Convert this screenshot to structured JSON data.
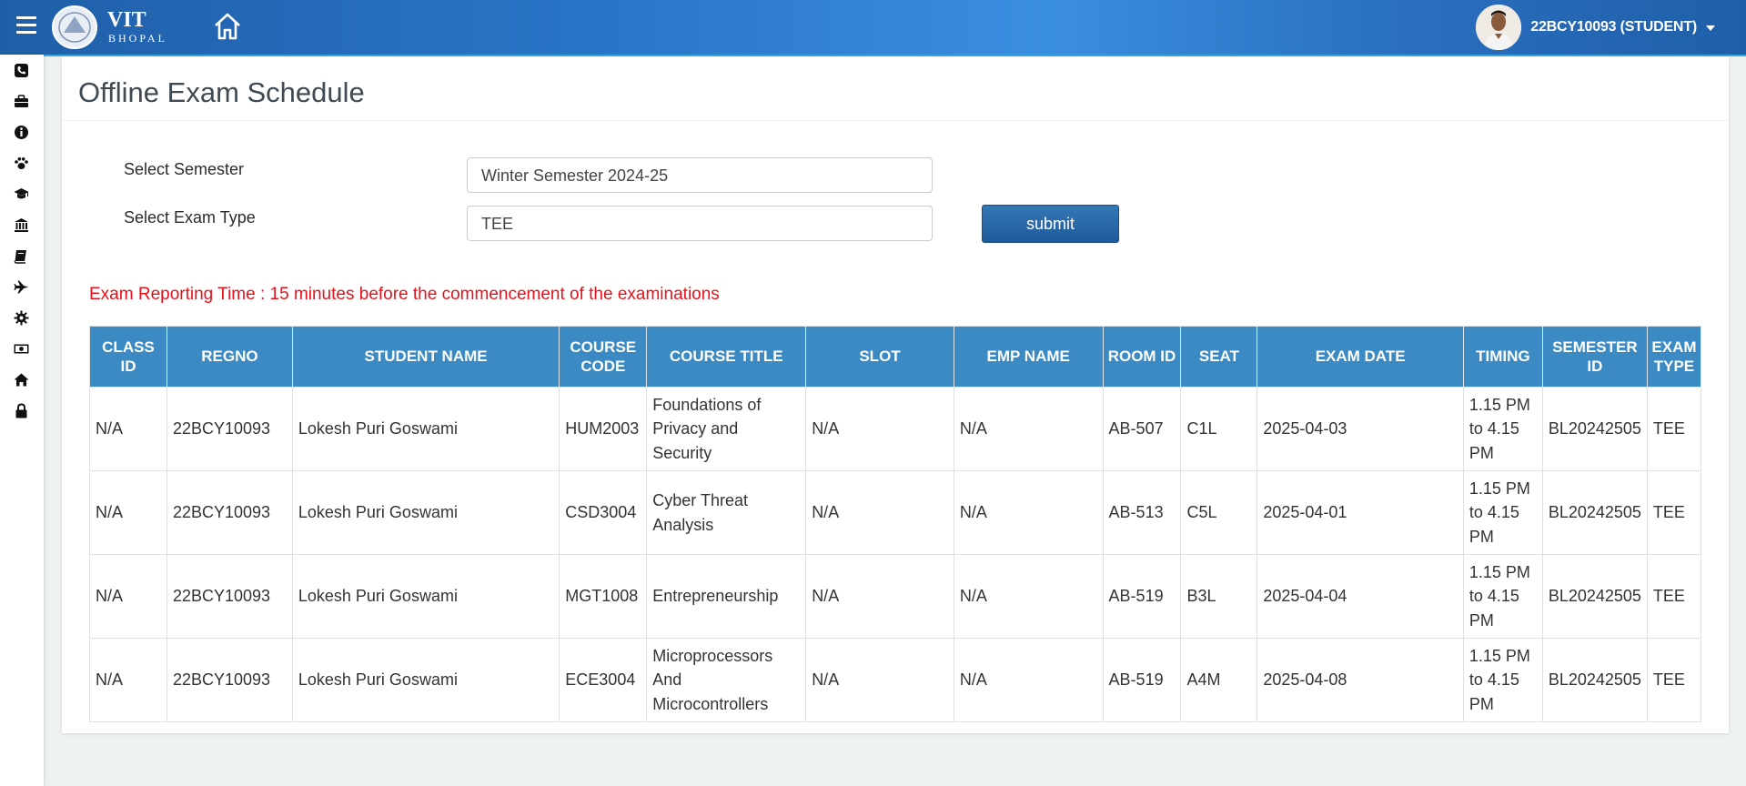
{
  "header": {
    "logo_text": "VIT",
    "logo_sub": "BHOPAL",
    "user_name": "22BCY10093 (STUDENT)"
  },
  "sidebar": {
    "icons": [
      "phone-icon",
      "briefcase-icon",
      "info-icon",
      "paw-icon",
      "graduation-cap-icon",
      "bank-icon",
      "book-icon",
      "plane-icon",
      "gear-icon",
      "money-icon",
      "home-icon",
      "lock-icon"
    ]
  },
  "page": {
    "title": "Offline Exam Schedule"
  },
  "form": {
    "semester_label": "Select Semester",
    "semester_value": "Winter Semester 2024-25",
    "exam_type_label": "Select Exam Type",
    "exam_type_value": "TEE",
    "submit_label": "submit"
  },
  "notice": {
    "label": "Exam Reporting Time :",
    "text": " 15 minutes before the commencement of the examinations"
  },
  "table": {
    "headers": [
      "CLASS ID",
      "REGNO",
      "STUDENT NAME",
      "COURSE CODE",
      "COURSE TITLE",
      "SLOT",
      "EMP NAME",
      "ROOM ID",
      "SEAT",
      "EXAM DATE",
      "TIMING",
      "SEMESTER ID",
      "EXAM TYPE"
    ],
    "rows": [
      [
        "N/A",
        "22BCY10093",
        "Lokesh Puri Goswami",
        "HUM2003",
        "Foundations of Privacy and Security",
        "N/A",
        "N/A",
        "AB-507",
        "C1L",
        "2025-04-03",
        "1.15 PM to 4.15 PM",
        "BL20242505",
        "TEE"
      ],
      [
        "N/A",
        "22BCY10093",
        "Lokesh Puri Goswami",
        "CSD3004",
        "Cyber Threat Analysis",
        "N/A",
        "N/A",
        "AB-513",
        "C5L",
        "2025-04-01",
        "1.15 PM to 4.15 PM",
        "BL20242505",
        "TEE"
      ],
      [
        "N/A",
        "22BCY10093",
        "Lokesh Puri Goswami",
        "MGT1008",
        "Entrepreneurship",
        "N/A",
        "N/A",
        "AB-519",
        "B3L",
        "2025-04-04",
        "1.15 PM to 4.15 PM",
        "BL20242505",
        "TEE"
      ],
      [
        "N/A",
        "22BCY10093",
        "Lokesh Puri Goswami",
        "ECE3004",
        "Microprocessors And Microcontrollers",
        "N/A",
        "N/A",
        "AB-519",
        "A4M",
        "2025-04-08",
        "1.15 PM to 4.15 PM",
        "BL20242505",
        "TEE"
      ]
    ]
  }
}
